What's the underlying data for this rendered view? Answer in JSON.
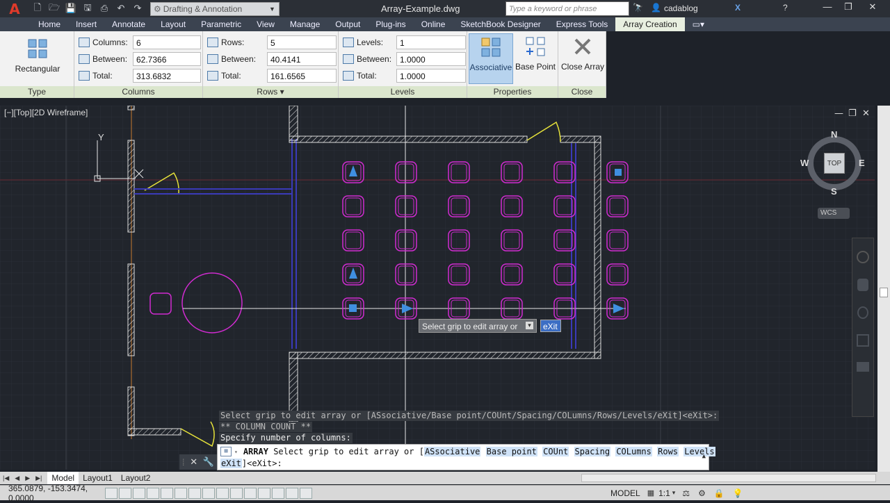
{
  "titlebar": {
    "app_logo": "A",
    "workspace": "Drafting & Annotation",
    "document_title": "Array-Example.dwg",
    "search_placeholder": "Type a keyword or phrase",
    "user": "cadablog"
  },
  "tabs": [
    "Home",
    "Insert",
    "Annotate",
    "Layout",
    "Parametric",
    "View",
    "Manage",
    "Output",
    "Plug-ins",
    "Online",
    "SketchBook Designer",
    "Express Tools",
    "Array Creation"
  ],
  "ribbon": {
    "type_panel": {
      "title": "Type",
      "button": "Rectangular"
    },
    "columns_panel": {
      "title": "Columns",
      "columns_label": "Columns:",
      "columns_value": "6",
      "between_label": "Between:",
      "between_value": "62.7366",
      "total_label": "Total:",
      "total_value": "313.6832"
    },
    "rows_panel": {
      "title": "Rows",
      "rows_label": "Rows:",
      "rows_value": "5",
      "between_label": "Between:",
      "between_value": "40.4141",
      "total_label": "Total:",
      "total_value": "161.6565"
    },
    "levels_panel": {
      "title": "Levels",
      "levels_label": "Levels:",
      "levels_value": "1",
      "between_label": "Between:",
      "between_value": "1.0000",
      "total_label": "Total:",
      "total_value": "1.0000"
    },
    "properties_panel": {
      "title": "Properties",
      "associative": "Associative",
      "base_point": "Base Point"
    },
    "close_panel": {
      "title": "Close",
      "close_array": "Close Array"
    }
  },
  "viewport": {
    "label": "[−][Top][2D Wireframe]",
    "compass": {
      "n": "N",
      "s": "S",
      "e": "E",
      "w": "W",
      "top": "TOP"
    },
    "wcs": "WCS",
    "ucs_y": "Y",
    "tooltip_prompt": "Select grip to edit array or",
    "tooltip_input": "eXit"
  },
  "command": {
    "history": [
      "Select grip to edit array or [ASsociative/Base point/COUnt/Spacing/COLumns/Rows/Levels/eXit]<eXit>:",
      "** COLUMN COUNT **",
      "Specify number of columns:"
    ],
    "prefix": "ARRAY",
    "prompt": "Select grip to edit array or [",
    "options": [
      "ASsociative",
      "Base point",
      "COUnt",
      "Spacing",
      "COLumns",
      "Rows",
      "Levels",
      "eXit"
    ],
    "suffix": "]<eXit>:"
  },
  "layout_tabs": [
    "Model",
    "Layout1",
    "Layout2"
  ],
  "status": {
    "coords": "365.0879, -153.3474, 0.0000",
    "model": "MODEL",
    "scale": "1:1"
  },
  "colors": {
    "magenta": "#d12bd1",
    "accent": "#3f8fe0",
    "ribbon_panel": "#dbe6cd"
  }
}
